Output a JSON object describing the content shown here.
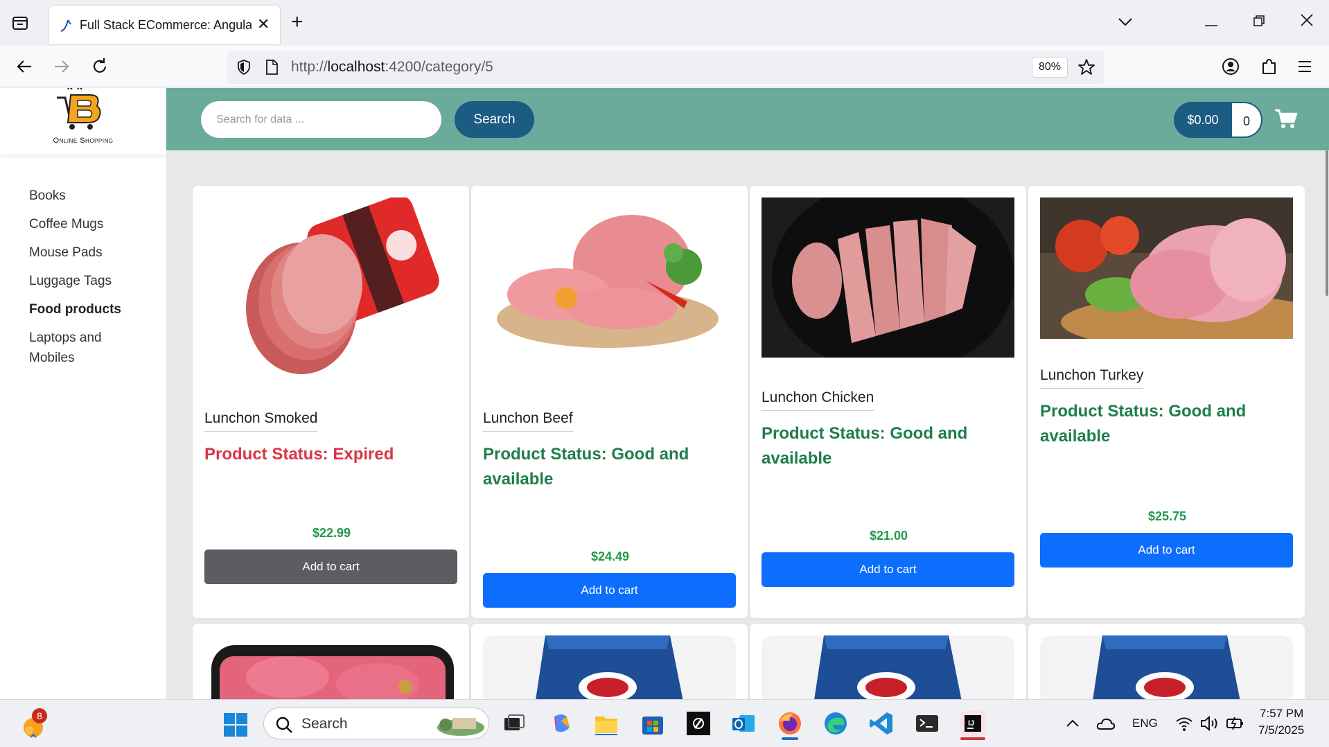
{
  "browser": {
    "tab_title": "Full Stack ECommerce: Angular",
    "url_prefix": "http://",
    "url_host": "localhost",
    "url_rest": ":4200/category/5",
    "zoom": "80%"
  },
  "logo": {
    "caption": "Online Shopping"
  },
  "sidebar": {
    "categories": [
      {
        "label": "Books",
        "active": false
      },
      {
        "label": "Coffee Mugs",
        "active": false
      },
      {
        "label": "Mouse Pads",
        "active": false
      },
      {
        "label": "Luggage Tags",
        "active": false
      },
      {
        "label": "Food products",
        "active": true
      },
      {
        "label": "Laptops and Mobiles",
        "active": false
      }
    ]
  },
  "header": {
    "search_placeholder": "Search for data ...",
    "search_button": "Search",
    "cart_total": "$0.00",
    "cart_quantity": "0"
  },
  "products": [
    {
      "name": "Lunchon Smoked",
      "status": "Product Status: Expired",
      "status_color": "#dc3545",
      "price": "$22.99",
      "button": "Add to cart",
      "button_color": "#5c5d62"
    },
    {
      "name": "Lunchon Beef",
      "status": "Product Status: Good and available",
      "status_color": "#1e7e4a",
      "price": "$24.49",
      "button": "Add to cart",
      "button_color": "#0d6efd"
    },
    {
      "name": "Lunchon Chicken",
      "status": "Product Status: Good and available",
      "status_color": "#1e7e4a",
      "price": "$21.00",
      "button": "Add to cart",
      "button_color": "#0d6efd"
    },
    {
      "name": "Lunchon Turkey",
      "status": "Product Status: Good and available",
      "status_color": "#1e7e4a",
      "price": "$25.75",
      "button": "Add to cart",
      "button_color": "#0d6efd"
    }
  ],
  "taskbar": {
    "notification_count": "8",
    "search_label": "Search",
    "language": "ENG",
    "time": "7:57 PM",
    "date": "7/5/2025"
  },
  "colors": {
    "header_bg": "#6aab9c",
    "primary_dark": "#1c5b82",
    "price_green": "#1f9a4a"
  }
}
